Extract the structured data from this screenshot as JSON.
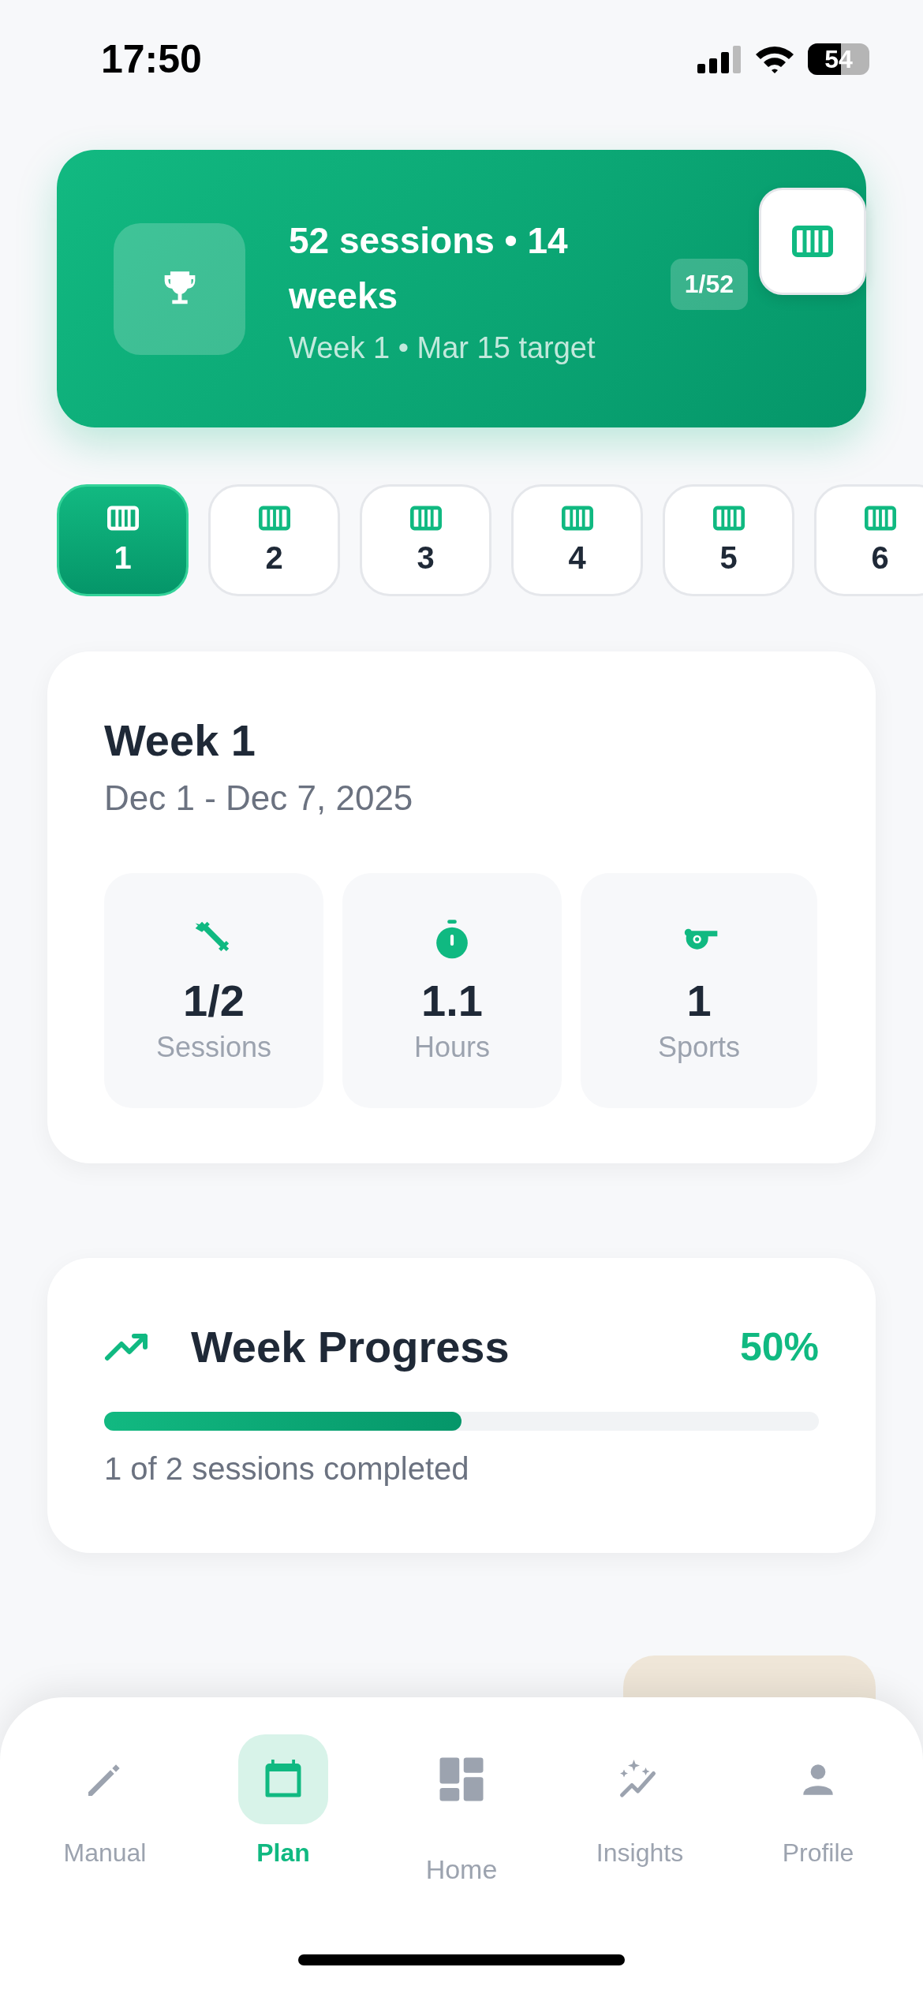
{
  "status_bar": {
    "time": "17:50",
    "battery": "54"
  },
  "hero": {
    "title": "52 sessions • 14 weeks",
    "subtitle": "Week 1 • Mar 15 target",
    "badge": "1/52"
  },
  "weeks": [
    {
      "label": "1",
      "selected": true
    },
    {
      "label": "2",
      "selected": false
    },
    {
      "label": "3",
      "selected": false
    },
    {
      "label": "4",
      "selected": false
    },
    {
      "label": "5",
      "selected": false
    },
    {
      "label": "6",
      "selected": false
    }
  ],
  "week_card": {
    "title": "Week 1",
    "dates": "Dec 1 - Dec 7, 2025",
    "stats": [
      {
        "kind": "sessions",
        "value": "1/2",
        "label": "Sessions"
      },
      {
        "kind": "hours",
        "value": "1.1",
        "label": "Hours"
      },
      {
        "kind": "sports",
        "value": "1",
        "label": "Sports"
      }
    ]
  },
  "progress": {
    "title": "Week Progress",
    "percent": "50%",
    "level": 0.5,
    "caption": "1 of 2 sessions completed"
  },
  "nav": [
    {
      "kind": "manual",
      "label": "Manual",
      "selected": false
    },
    {
      "kind": "plan",
      "label": "Plan",
      "selected": true
    },
    {
      "kind": "home",
      "label": "Home",
      "selected": false
    },
    {
      "kind": "insights",
      "label": "Insights",
      "selected": false
    },
    {
      "kind": "profile",
      "label": "Profile",
      "selected": false
    }
  ]
}
